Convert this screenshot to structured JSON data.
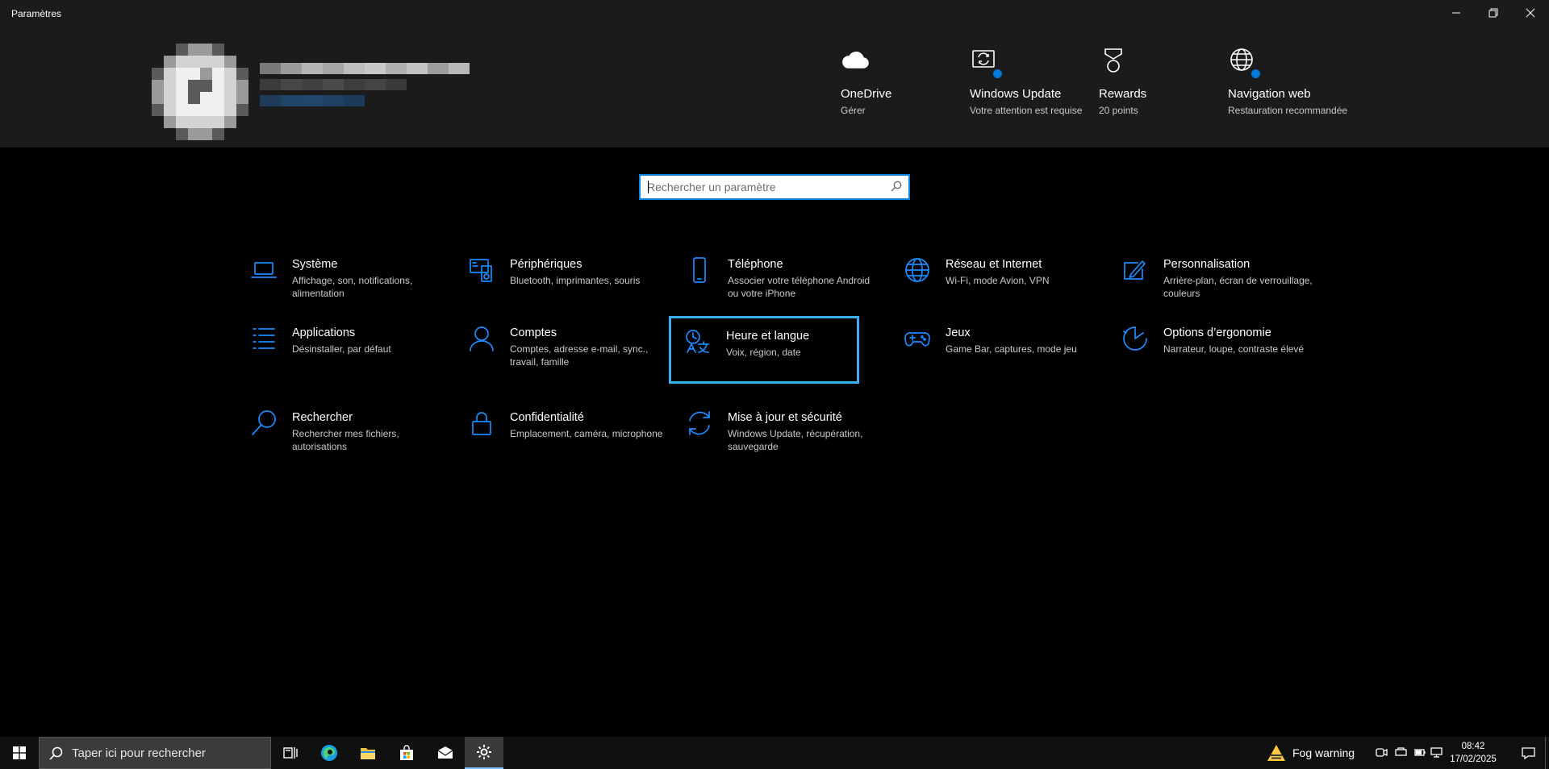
{
  "window": {
    "title": "Paramètres",
    "minimize_icon": "minimize-icon",
    "maximize_icon": "restore-icon",
    "close_icon": "close-icon"
  },
  "header": {
    "items": [
      {
        "name": "OneDrive",
        "sub": "Gérer",
        "icon": "cloud-icon",
        "badge": false
      },
      {
        "name": "Windows Update",
        "sub": "Votre attention est requise",
        "icon": "windows-update-icon",
        "badge": true
      },
      {
        "name": "Rewards",
        "sub": "20 points",
        "icon": "medal-icon",
        "badge": false
      },
      {
        "name": "Navigation web",
        "sub": "Restauration recommandée",
        "icon": "globe-icon",
        "badge": true
      }
    ]
  },
  "search": {
    "placeholder": "Rechercher un paramètre",
    "value": ""
  },
  "categories": [
    {
      "name": "Système",
      "desc": "Affichage, son, notifications, alimentation",
      "icon": "laptop-icon"
    },
    {
      "name": "Périphériques",
      "desc": "Bluetooth, imprimantes, souris",
      "icon": "devices-icon"
    },
    {
      "name": "Téléphone",
      "desc": "Associer votre téléphone Android ou votre iPhone",
      "icon": "phone-icon"
    },
    {
      "name": "Réseau et Internet",
      "desc": "Wi-Fi, mode Avion, VPN",
      "icon": "globe-icon"
    },
    {
      "name": "Personnalisation",
      "desc": "Arrière-plan, écran de verrouillage, couleurs",
      "icon": "paint-icon"
    },
    {
      "name": "Applications",
      "desc": "Désinstaller, par défaut",
      "icon": "list-icon"
    },
    {
      "name": "Comptes",
      "desc": "Comptes, adresse e-mail, sync., travail, famille",
      "icon": "person-icon"
    },
    {
      "name": "Heure et langue",
      "desc": "Voix, région, date",
      "icon": "time-language-icon"
    },
    {
      "name": "Jeux",
      "desc": "Game Bar, captures, mode jeu",
      "icon": "gamepad-icon"
    },
    {
      "name": "Options d’ergonomie",
      "desc": "Narrateur, loupe, contraste élevé",
      "icon": "ease-of-access-icon"
    },
    {
      "name": "Rechercher",
      "desc": "Rechercher mes fichiers, autorisations",
      "icon": "search-icon"
    },
    {
      "name": "Confidentialité",
      "desc": "Emplacement, caméra, microphone",
      "icon": "lock-icon"
    },
    {
      "name": "Mise à jour et sécurité",
      "desc": "Windows Update, récupération, sauvegarde",
      "icon": "sync-icon"
    }
  ],
  "taskbar": {
    "search_text": "Taper ici pour rechercher",
    "apps": [
      "task-view-icon",
      "edge-icon",
      "file-explorer-icon",
      "store-icon",
      "mail-icon",
      "settings-icon"
    ],
    "weather": "Fog warning",
    "time": "08:42",
    "date": "17/02/2025"
  },
  "colors": {
    "accent": "#1a8cff",
    "header_bg": "#1b1b1b",
    "focus_outline": "#3ab0f0",
    "badge": "#0078d7"
  }
}
